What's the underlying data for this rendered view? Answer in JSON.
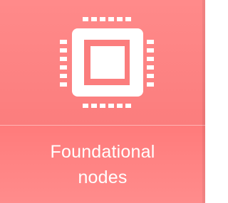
{
  "tile": {
    "icon": "cpu-chip-icon",
    "label_line1": "Foundational",
    "label_line2": "nodes",
    "colors": {
      "background": "#ff8a8a",
      "foreground": "#ffffff"
    }
  }
}
